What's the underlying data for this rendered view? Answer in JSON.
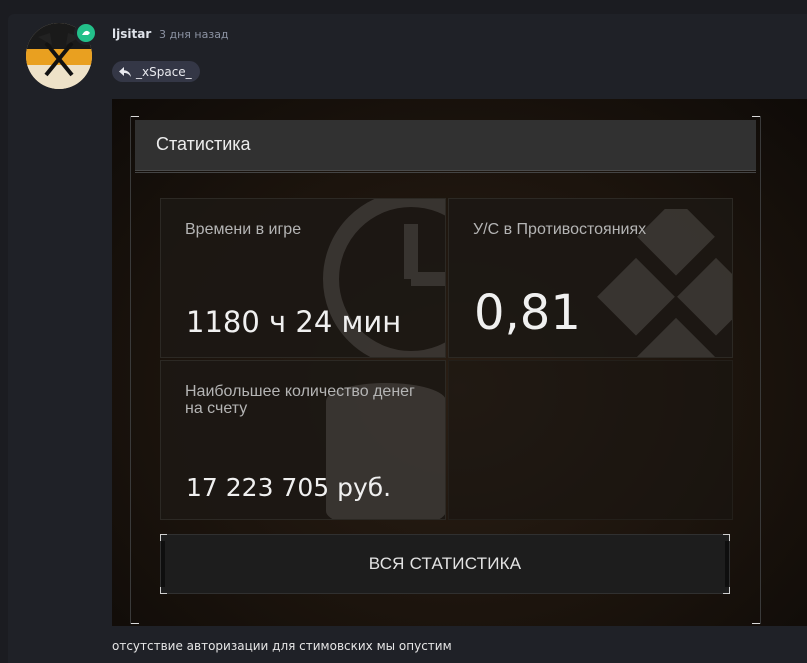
{
  "post": {
    "username": "ljsitar",
    "timestamp": "3 дня назад",
    "reply_to": "_xSpace_",
    "comment_text": "отсутствие авторизации для стимовских мы опустим"
  },
  "stats": {
    "header_title": "Статистика",
    "tiles": [
      {
        "label": "Времени в игре",
        "value": "1180 ч 24 мин"
      },
      {
        "label": "У/С в Противостояниях",
        "value": "0,81"
      },
      {
        "label": "Наибольшее количество денег на счету",
        "value": "17 223 705 руб."
      }
    ],
    "all_stats_button": "ВСЯ СТАТИСТИКА"
  },
  "colors": {
    "page_bg": "#1b1c21",
    "post_bg": "#1f2127",
    "online_badge": "#23c08a",
    "reply_chip_bg": "#343746"
  },
  "icons": {
    "avatar_badge": "online-badge-icon",
    "reply": "reply-arrow-icon"
  }
}
